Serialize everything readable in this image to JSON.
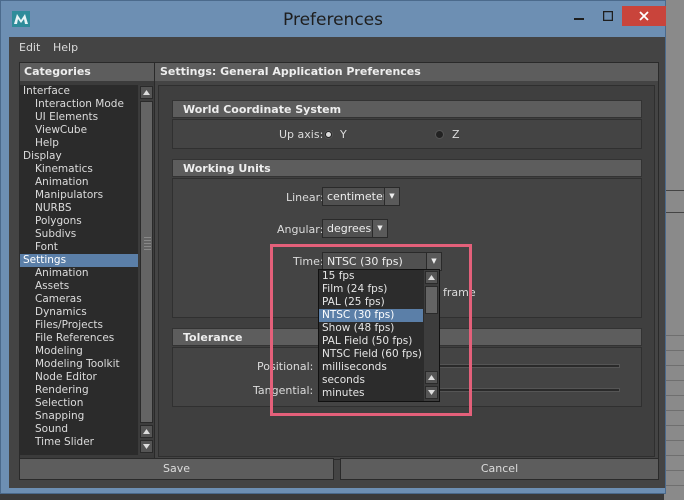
{
  "window": {
    "title": "Preferences"
  },
  "menubar": {
    "items": [
      "Edit",
      "Help"
    ]
  },
  "categories": {
    "header": "Categories",
    "items": [
      {
        "label": "Interface",
        "sub": false
      },
      {
        "label": "Interaction Mode",
        "sub": true
      },
      {
        "label": "UI Elements",
        "sub": true
      },
      {
        "label": "ViewCube",
        "sub": true
      },
      {
        "label": "Help",
        "sub": true
      },
      {
        "label": "Display",
        "sub": false
      },
      {
        "label": "Kinematics",
        "sub": true
      },
      {
        "label": "Animation",
        "sub": true
      },
      {
        "label": "Manipulators",
        "sub": true
      },
      {
        "label": "NURBS",
        "sub": true
      },
      {
        "label": "Polygons",
        "sub": true
      },
      {
        "label": "Subdivs",
        "sub": true
      },
      {
        "label": "Font",
        "sub": true
      },
      {
        "label": "Settings",
        "sub": false,
        "selected": true
      },
      {
        "label": "Animation",
        "sub": true
      },
      {
        "label": "Assets",
        "sub": true
      },
      {
        "label": "Cameras",
        "sub": true
      },
      {
        "label": "Dynamics",
        "sub": true
      },
      {
        "label": "Files/Projects",
        "sub": true
      },
      {
        "label": "File References",
        "sub": true
      },
      {
        "label": "Modeling",
        "sub": true
      },
      {
        "label": "Modeling Toolkit",
        "sub": true
      },
      {
        "label": "Node Editor",
        "sub": true
      },
      {
        "label": "Rendering",
        "sub": true
      },
      {
        "label": "Selection",
        "sub": true
      },
      {
        "label": "Snapping",
        "sub": true
      },
      {
        "label": "Sound",
        "sub": true
      },
      {
        "label": "Time Slider",
        "sub": true
      }
    ]
  },
  "settings": {
    "header": "Settings: General Application Preferences",
    "world_coord": {
      "title": "World Coordinate System",
      "up_axis_label": "Up axis:",
      "options": [
        "Y",
        "Z"
      ],
      "selected": "Y"
    },
    "working_units": {
      "title": "Working Units",
      "linear_label": "Linear:",
      "linear_value": "centimeter",
      "angular_label": "Angular:",
      "angular_value": "degrees",
      "time_label": "Time:",
      "time_value": "NTSC (30 fps)",
      "partial_text": "frame"
    },
    "tolerance": {
      "title": "Tolerance",
      "positional_label": "Positional:",
      "tangential_label": "Tangential:"
    }
  },
  "time_dropdown": {
    "options": [
      "15 fps",
      "Film (24 fps)",
      "PAL (25 fps)",
      "NTSC (30 fps)",
      "Show (48 fps)",
      "PAL Field (50 fps)",
      "NTSC Field (60 fps)",
      "milliseconds",
      "seconds",
      "minutes"
    ],
    "selected": "NTSC (30 fps)"
  },
  "buttons": {
    "save": "Save",
    "cancel": "Cancel"
  },
  "colors": {
    "selection": "#5b7fa8",
    "highlight_box": "#e4607a",
    "title_bar": "#6d8fb3",
    "close_button": "#c9443b"
  },
  "icons": [
    "maya-app-icon",
    "minimize-icon",
    "maximize-icon",
    "close-icon",
    "chevron-down-icon",
    "scroll-up-icon",
    "scroll-down-icon"
  ]
}
